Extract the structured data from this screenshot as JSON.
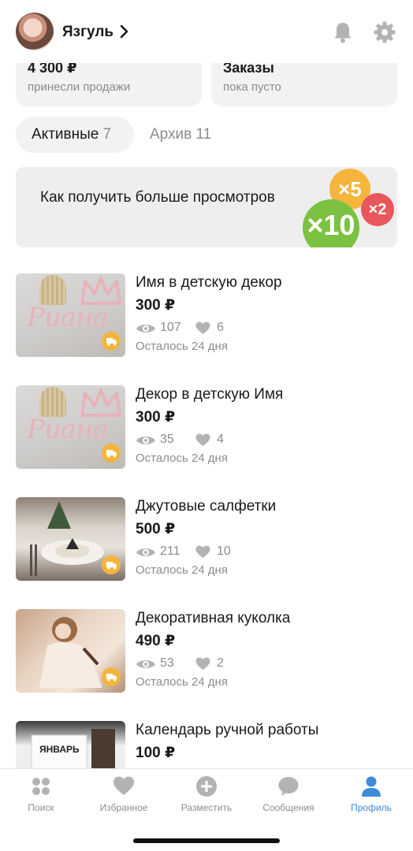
{
  "header": {
    "username": "Язгуль"
  },
  "stats": {
    "sales": {
      "value": "4 300 ₽",
      "caption": "принесли продажи"
    },
    "orders": {
      "value": "Заказы",
      "caption": "пока пусто"
    }
  },
  "tabs": [
    {
      "label": "Активные",
      "count": "7"
    },
    {
      "label": "Архив",
      "count": "11"
    }
  ],
  "promo": {
    "text": "Как получить больше просмотров",
    "badges": [
      "×5",
      "×2",
      "×10"
    ]
  },
  "listings": [
    {
      "title": "Имя в детскую декор",
      "price": "300 ₽",
      "views": "107",
      "likes": "6",
      "remaining": "Осталось 24 дня",
      "photo_text": "Риана"
    },
    {
      "title": "Декор в детскую Имя",
      "price": "300 ₽",
      "views": "35",
      "likes": "4",
      "remaining": "Осталось 24 дня",
      "photo_text": "Риана"
    },
    {
      "title": "Джутовые салфетки",
      "price": "500 ₽",
      "views": "211",
      "likes": "10",
      "remaining": "Осталось 24 дня"
    },
    {
      "title": "Декоративная куколка",
      "price": "490 ₽",
      "views": "53",
      "likes": "2",
      "remaining": "Осталось 24 дня"
    },
    {
      "title": "Календарь ручной работы",
      "price": "100 ₽",
      "photo_text": "ЯНВАРЬ"
    }
  ],
  "nav": [
    {
      "label": "Поиск",
      "icon": "search-dots-icon"
    },
    {
      "label": "Избранное",
      "icon": "heart-icon"
    },
    {
      "label": "Разместить",
      "icon": "plus-circle-icon"
    },
    {
      "label": "Сообщения",
      "icon": "chat-bubble-icon"
    },
    {
      "label": "Профиль",
      "icon": "person-icon"
    }
  ],
  "colors": {
    "accent": "#3d8bd9",
    "icon_gray": "#b3b3b3",
    "badge_yellow": "#f5b53d",
    "badge_red": "#e8575b",
    "badge_green": "#7cc242",
    "card_bg": "#f2f2f2"
  }
}
